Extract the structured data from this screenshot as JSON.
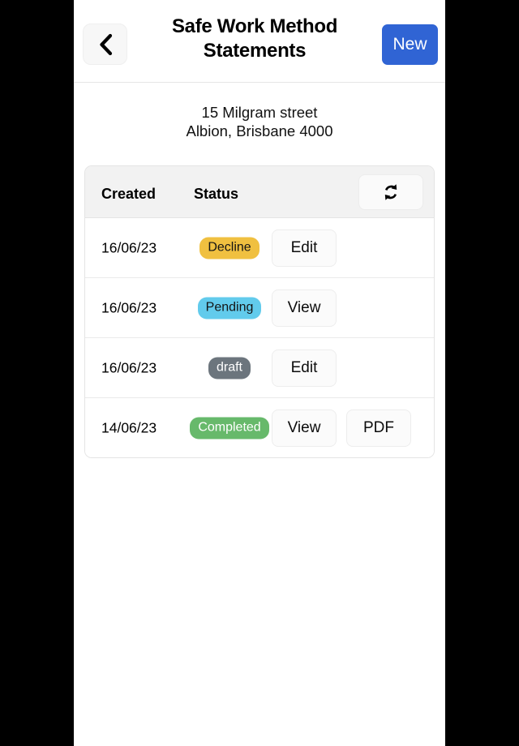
{
  "navbar": {
    "back_icon": "chevron-left-icon",
    "title_line1": "Safe Work Method",
    "title_line2": "Statements",
    "new_label": "New",
    "new_color": "#3064d4"
  },
  "address": {
    "line1": "15 Milgram street",
    "line2": "Albion, Brisbane 4000"
  },
  "table": {
    "columns": [
      "Created",
      "Status"
    ],
    "refresh_icon": "refresh-icon",
    "rows": [
      {
        "created": "16/06/23",
        "status": "Decline",
        "status_color": "#f0c040",
        "actions": [
          "Edit"
        ]
      },
      {
        "created": "16/06/23",
        "status": "Pending",
        "status_color": "#62cbec",
        "actions": [
          "View"
        ]
      },
      {
        "created": "16/06/23",
        "status": "draft",
        "status_color": "#6c757d",
        "actions": [
          "Edit"
        ]
      },
      {
        "created": "14/06/23",
        "status": "Completed",
        "status_color": "#67b96b",
        "actions": [
          "View",
          "PDF"
        ]
      }
    ]
  }
}
